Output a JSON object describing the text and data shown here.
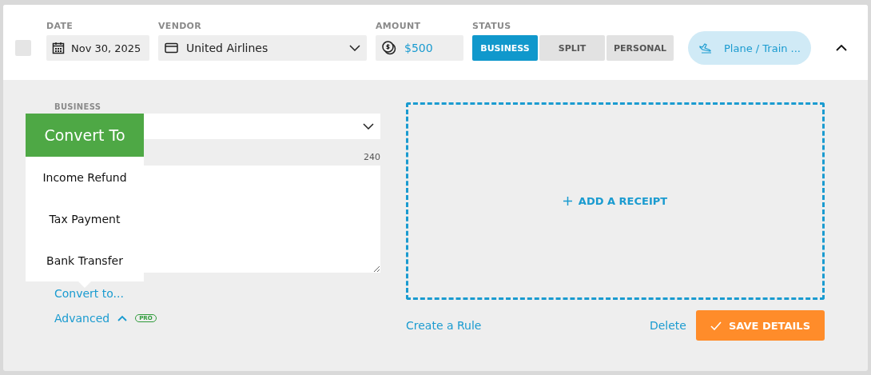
{
  "row": {
    "checked": false,
    "date": {
      "label": "DATE",
      "value": "Nov 30, 2025"
    },
    "vendor": {
      "label": "VENDOR",
      "value": "United Airlines"
    },
    "amount": {
      "label": "AMOUNT",
      "value": "$500"
    },
    "status": {
      "label": "STATUS",
      "options": [
        {
          "label": "BUSINESS",
          "selected": true
        },
        {
          "label": "SPLIT",
          "selected": false
        },
        {
          "label": "PERSONAL",
          "selected": false
        }
      ]
    },
    "category": "Plane / Train ...",
    "expanded": true
  },
  "details": {
    "business_label": "BUSINESS",
    "char_count": "240",
    "convert_link": "Convert to...",
    "advanced_link": "Advanced",
    "advanced_expanded": true,
    "pro_badge": "PRO",
    "receipt": "ADD A RECEIPT",
    "rule_link": "Create a Rule",
    "delete_link": "Delete",
    "save_button": "SAVE DETAILS"
  },
  "convert_menu": {
    "title": "Convert To",
    "items": [
      "Income Refund",
      "Tax Payment",
      "Bank Transfer"
    ]
  }
}
